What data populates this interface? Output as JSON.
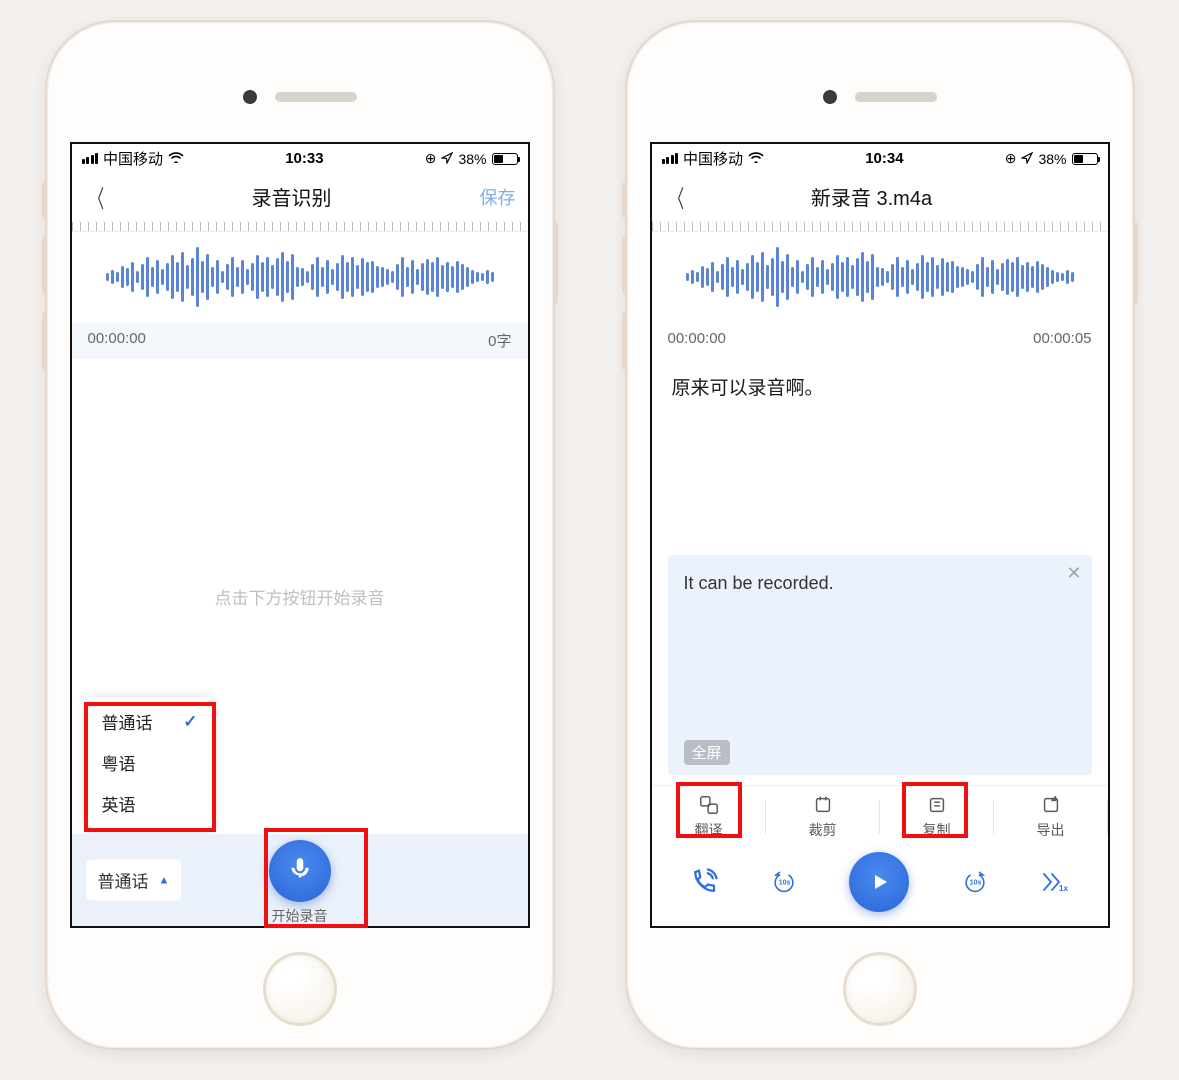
{
  "left": {
    "status": {
      "carrier": "中国移动",
      "time": "10:33",
      "battery": "38%"
    },
    "nav": {
      "title": "录音识别",
      "save": "保存"
    },
    "meta": {
      "time": "00:00:00",
      "count": "0字"
    },
    "placeholder": "点击下方按钮开始录音",
    "languages": {
      "items": [
        "普通话",
        "粤语",
        "英语"
      ],
      "selected": "普通话"
    },
    "record_label": "开始录音"
  },
  "right": {
    "status": {
      "carrier": "中国移动",
      "time": "10:34",
      "battery": "38%"
    },
    "nav": {
      "title": "新录音 3.m4a"
    },
    "meta": {
      "start": "00:00:00",
      "end": "00:00:05"
    },
    "transcript": "原来可以录音啊。",
    "translation": "It can be recorded.",
    "fullscreen": "全屏",
    "tools": {
      "translate": "翻译",
      "trim": "裁剪",
      "copy": "复制",
      "export": "导出"
    },
    "skip": "10s",
    "speed": "1x"
  }
}
